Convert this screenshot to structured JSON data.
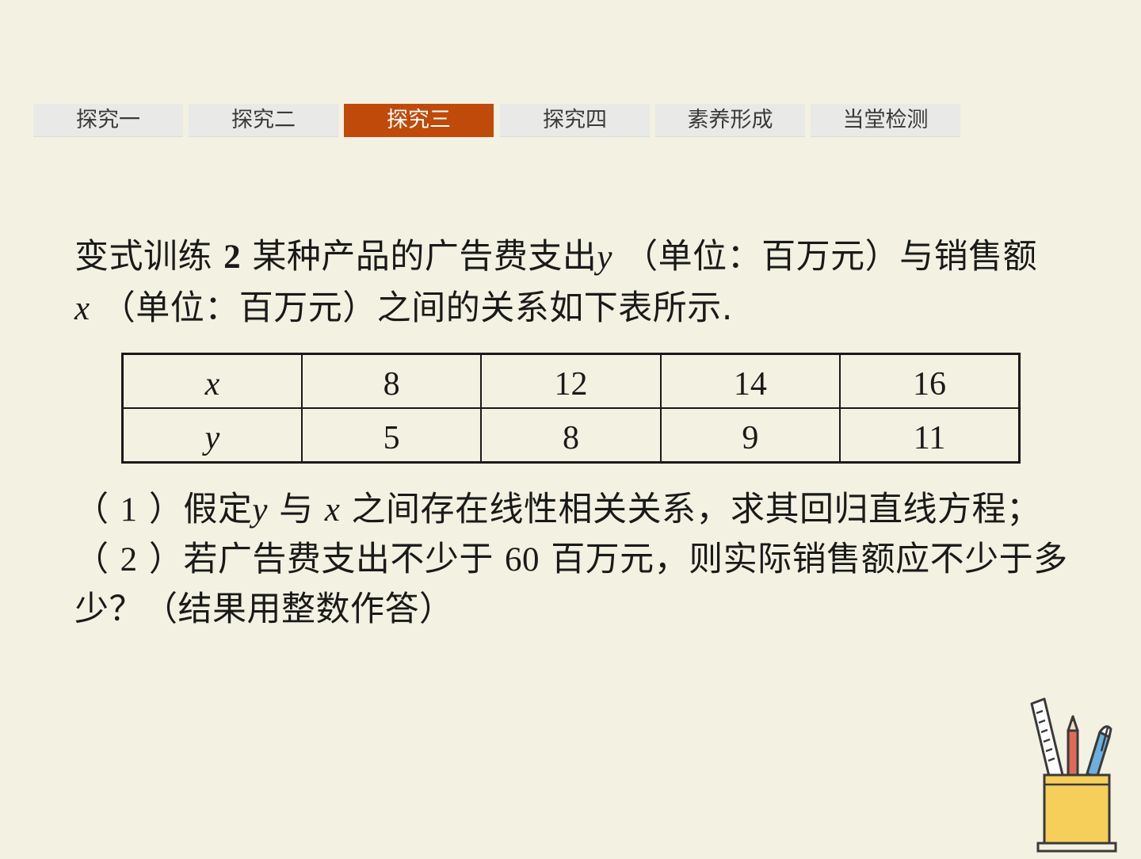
{
  "tabs": [
    {
      "label": "探究一",
      "active": false
    },
    {
      "label": "探究二",
      "active": false
    },
    {
      "label": "探究三",
      "active": true
    },
    {
      "label": "探究四",
      "active": false
    },
    {
      "label": "素养形成",
      "active": false
    },
    {
      "label": "当堂检测",
      "active": false
    }
  ],
  "problem": {
    "prefix": "变式训练",
    "number": "2",
    "line1_a": "某种产品的广告费支出",
    "var_y": "y",
    "line1_b": "（单位：百万元）与销售额",
    "var_x": "x",
    "line2_b": "（单位：百万元）之间的关系如下表所示."
  },
  "table": {
    "rows": [
      {
        "head": "x",
        "cells": [
          "8",
          "12",
          "14",
          "16"
        ]
      },
      {
        "head": "y",
        "cells": [
          "5",
          "8",
          "9",
          "11"
        ]
      }
    ]
  },
  "questions": {
    "q1_open": "（",
    "q1_num": "1",
    "q1_a": "）假定",
    "q1_y": "y",
    "q1_b": "与",
    "q1_x": "x",
    "q1_c": "之间存在线性相关关系，求其回归直线方程；",
    "q2_open": "（",
    "q2_num": "2",
    "q2_a": "）若广告费支出不少于",
    "q2_val": "60",
    "q2_b": "百万元，则实际销售额应不少于多",
    "q2_c": "少？（结果用整数作答）"
  },
  "colors": {
    "background": "#f3f1e1",
    "tab_active": "#c04a0a",
    "tab_inactive": "#e9e9e7",
    "cup": "#f5cf5a"
  },
  "icons": {
    "decoration": "pencil-cup-icon"
  }
}
